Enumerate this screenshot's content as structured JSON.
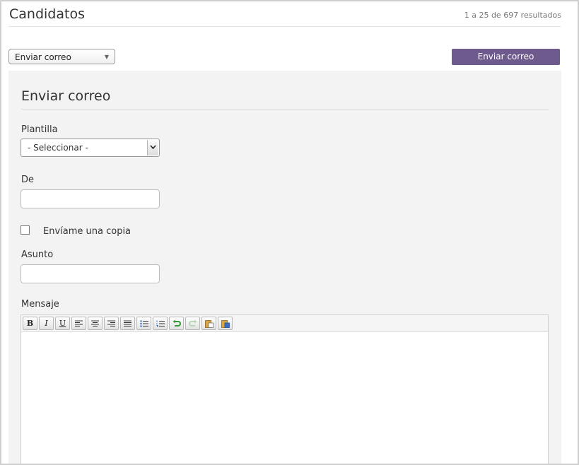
{
  "header": {
    "title": "Candidatos",
    "results": "1 a 25 de 697 resultados"
  },
  "actions": {
    "select_value": "Enviar correo",
    "send_button": "Enviar correo"
  },
  "form": {
    "title": "Enviar correo",
    "template_label": "Plantilla",
    "template_value": "- Seleccionar -",
    "from_label": "De",
    "from_value": "",
    "copy_label": "Envíame una copia",
    "copy_checked": false,
    "subject_label": "Asunto",
    "subject_value": "",
    "message_label": "Mensaje"
  },
  "editor": {
    "toolbar": [
      "bold-icon",
      "italic-icon",
      "underline-icon",
      "align-left-icon",
      "align-center-icon",
      "align-right-icon",
      "align-justify-icon",
      "bullet-list-icon",
      "numbered-list-icon",
      "undo-icon",
      "redo-icon",
      "paste-icon",
      "paste-word-icon"
    ],
    "bold_glyph": "B",
    "italic_glyph": "I",
    "underline_glyph": "U"
  },
  "colors": {
    "accent": "#6f5a8e",
    "panel_bg": "#f3f3f3"
  }
}
